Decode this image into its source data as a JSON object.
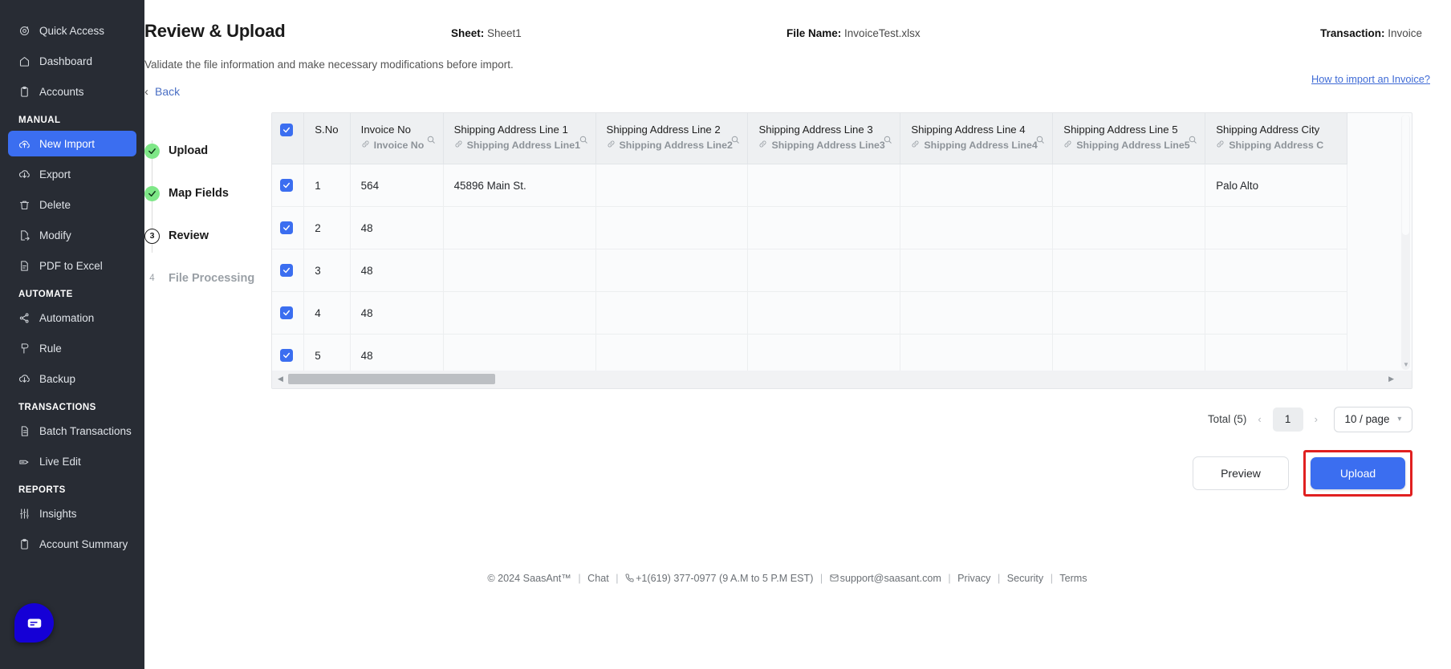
{
  "sidebar": {
    "top_items": [
      {
        "label": "Quick Access",
        "icon": "target-icon"
      },
      {
        "label": "Dashboard",
        "icon": "home-icon"
      },
      {
        "label": "Accounts",
        "icon": "clipboard-icon"
      }
    ],
    "sections": [
      {
        "title": "MANUAL",
        "items": [
          {
            "label": "New Import",
            "icon": "upload-cloud-icon",
            "active": true
          },
          {
            "label": "Export",
            "icon": "download-cloud-icon",
            "active": false
          },
          {
            "label": "Delete",
            "icon": "trash-icon",
            "active": false
          },
          {
            "label": "Modify",
            "icon": "file-edit-icon",
            "active": false
          },
          {
            "label": "PDF to Excel",
            "icon": "file-pdf-icon",
            "active": false
          }
        ]
      },
      {
        "title": "AUTOMATE",
        "items": [
          {
            "label": "Automation",
            "icon": "share-nodes-icon",
            "active": false
          },
          {
            "label": "Rule",
            "icon": "rule-icon",
            "active": false
          },
          {
            "label": "Backup",
            "icon": "download-cloud-icon",
            "active": false
          }
        ]
      },
      {
        "title": "TRANSACTIONS",
        "items": [
          {
            "label": "Batch Transactions",
            "icon": "document-icon",
            "active": false
          },
          {
            "label": "Live Edit",
            "icon": "pencil-tag-icon",
            "active": false
          }
        ]
      },
      {
        "title": "REPORTS",
        "items": [
          {
            "label": "Insights",
            "icon": "sliders-icon",
            "active": false
          },
          {
            "label": "Account Summary",
            "icon": "clipboard-icon",
            "active": false
          }
        ]
      }
    ],
    "chat_icon": "chat-bubble-icon"
  },
  "header": {
    "title": "Review & Upload",
    "subtitle": "Validate the file information and make necessary modifications before import.",
    "sheet_label": "Sheet:",
    "sheet_value": "Sheet1",
    "file_label": "File Name:",
    "file_value": "InvoiceTest.xlsx",
    "transaction_label": "Transaction:",
    "transaction_value": "Invoice",
    "help_link": "How to import an Invoice?",
    "back_label": "Back"
  },
  "stepper": {
    "steps": [
      {
        "num": "1",
        "label": "Upload",
        "state": "done"
      },
      {
        "num": "2",
        "label": "Map Fields",
        "state": "done"
      },
      {
        "num": "3",
        "label": "Review",
        "state": "current"
      },
      {
        "num": "4",
        "label": "File Processing",
        "state": "todo"
      }
    ]
  },
  "table": {
    "columns": [
      {
        "title": "S.No",
        "mapped": "",
        "searchable": false,
        "cls": "col-sno"
      },
      {
        "title": "Invoice No",
        "mapped": "Invoice No",
        "searchable": true,
        "cls": "col-inv"
      },
      {
        "title": "Shipping Address Line 1",
        "mapped": "Shipping Address Line1",
        "searchable": true,
        "cls": "col-addr"
      },
      {
        "title": "Shipping Address Line 2",
        "mapped": "Shipping Address Line2",
        "searchable": true,
        "cls": "col-addr"
      },
      {
        "title": "Shipping Address Line 3",
        "mapped": "Shipping Address Line3",
        "searchable": true,
        "cls": "col-addr"
      },
      {
        "title": "Shipping Address Line 4",
        "mapped": "Shipping Address Line4",
        "searchable": true,
        "cls": "col-addr"
      },
      {
        "title": "Shipping Address Line 5",
        "mapped": "Shipping Address Line5",
        "searchable": true,
        "cls": "col-addr"
      },
      {
        "title": "Shipping Address City",
        "mapped": "Shipping Address C",
        "searchable": false,
        "cls": "col-city"
      }
    ],
    "rows": [
      {
        "checked": true,
        "cells": [
          "1",
          "564",
          "45896 Main St.",
          "",
          "",
          "",
          "",
          "Palo Alto"
        ]
      },
      {
        "checked": true,
        "cells": [
          "2",
          "48",
          "",
          "",
          "",
          "",
          "",
          ""
        ]
      },
      {
        "checked": true,
        "cells": [
          "3",
          "48",
          "",
          "",
          "",
          "",
          "",
          ""
        ]
      },
      {
        "checked": true,
        "cells": [
          "4",
          "48",
          "",
          "",
          "",
          "",
          "",
          ""
        ]
      },
      {
        "checked": true,
        "cells": [
          "5",
          "48",
          "",
          "",
          "",
          "",
          "",
          ""
        ]
      }
    ],
    "header_checked": true
  },
  "pagination": {
    "total": "Total (5)",
    "prev": "‹",
    "page": "1",
    "next": "›",
    "page_size": "10 / page"
  },
  "actions": {
    "preview": "Preview",
    "upload": "Upload",
    "highlight_color": "#e02020",
    "primary_color": "#3b6ef0"
  },
  "footer": {
    "copyright": "© 2024 SaasAnt™",
    "chat": "Chat",
    "phone": "+1(619) 377-0977 (9 A.M to 5 P.M EST)",
    "email": "support@saasant.com",
    "privacy": "Privacy",
    "security": "Security",
    "terms": "Terms"
  }
}
